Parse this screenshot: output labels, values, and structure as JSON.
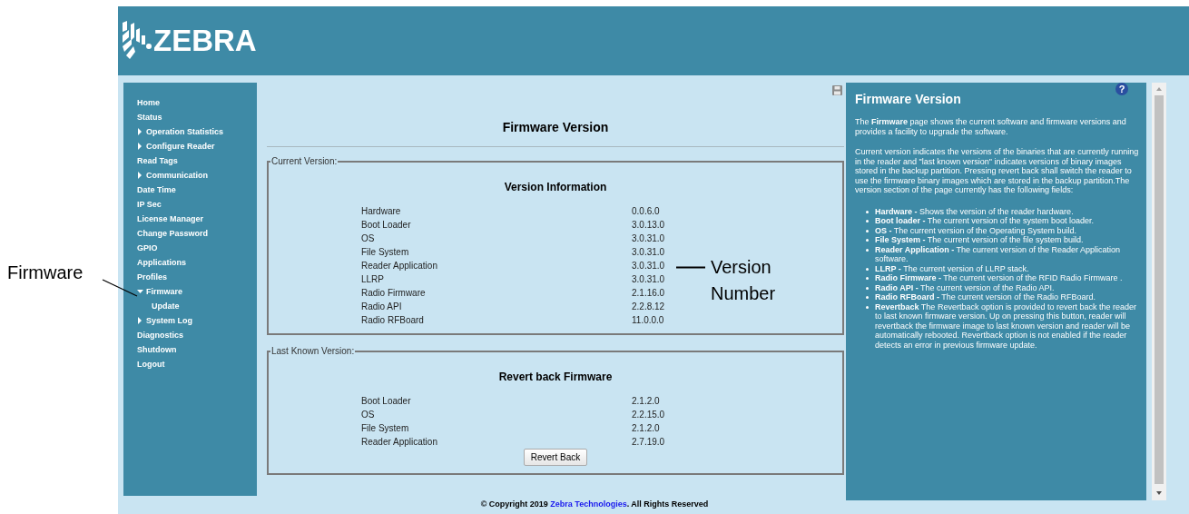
{
  "header": {
    "brand": "ZEBRA"
  },
  "sidebar": {
    "items": [
      {
        "label": "Home",
        "kind": "link"
      },
      {
        "label": "Status",
        "kind": "link"
      },
      {
        "label": "Operation Statistics",
        "kind": "group",
        "expanded": false
      },
      {
        "label": "Configure Reader",
        "kind": "group",
        "expanded": false
      },
      {
        "label": "Read Tags",
        "kind": "link"
      },
      {
        "label": "Communication",
        "kind": "group",
        "expanded": false
      },
      {
        "label": "Date Time",
        "kind": "link"
      },
      {
        "label": "IP Sec",
        "kind": "link"
      },
      {
        "label": "License Manager",
        "kind": "link"
      },
      {
        "label": "Change Password",
        "kind": "link"
      },
      {
        "label": "GPIO",
        "kind": "link"
      },
      {
        "label": "Applications",
        "kind": "link"
      },
      {
        "label": "Profiles",
        "kind": "link"
      },
      {
        "label": "Firmware",
        "kind": "group",
        "expanded": true,
        "children": [
          {
            "label": "Update",
            "kind": "link"
          }
        ]
      },
      {
        "label": "System Log",
        "kind": "group",
        "expanded": false
      },
      {
        "label": "Diagnostics",
        "kind": "link"
      },
      {
        "label": "Shutdown",
        "kind": "link"
      },
      {
        "label": "Logout",
        "kind": "link"
      }
    ]
  },
  "main": {
    "title": "Firmware Version",
    "sections": [
      {
        "legend": "Current Version:",
        "heading": "Version Information",
        "rows": [
          {
            "name": "Hardware",
            "value": "0.0.6.0"
          },
          {
            "name": "Boot Loader",
            "value": "3.0.13.0"
          },
          {
            "name": "OS",
            "value": "3.0.31.0"
          },
          {
            "name": "File System",
            "value": "3.0.31.0"
          },
          {
            "name": "Reader Application",
            "value": "3.0.31.0"
          },
          {
            "name": "LLRP",
            "value": "3.0.31.0"
          },
          {
            "name": "Radio Firmware",
            "value": "2.1.16.0"
          },
          {
            "name": "Radio API",
            "value": "2.2.8.12"
          },
          {
            "name": "Radio RFBoard",
            "value": "11.0.0.0"
          }
        ]
      },
      {
        "legend": "Last Known Version:",
        "heading": "Revert back Firmware",
        "rows": [
          {
            "name": "Boot Loader",
            "value": "2.1.2.0"
          },
          {
            "name": "OS",
            "value": "2.2.15.0"
          },
          {
            "name": "File System",
            "value": "2.1.2.0"
          },
          {
            "name": "Reader Application",
            "value": "2.7.19.0"
          }
        ],
        "button": "Revert Back"
      }
    ],
    "footer": {
      "prefix": "© Copyright 2019 ",
      "link": "Zebra Technologies",
      "suffix": ". All Rights Reserved"
    }
  },
  "help": {
    "button": "?",
    "title": "Firmware Version",
    "paragraphs": [
      "The **Firmware** page shows the current software and firmware versions and provides a facility to upgrade the software.",
      "Current version indicates the versions of the binaries that are currently running in the reader and \"last known version\" indicates versions of binary images stored in the backup partition. Pressing revert back shall switch the reader to use the firmware binary images which are stored in the backup partition.The version section of the page currently has the following fields:"
    ],
    "bullets": [
      "**Hardware -** Shows the version of the reader hardware.",
      "**Boot loader -** The current version of the system boot loader.",
      "**OS -** The current version of the Operating System build.",
      "**File System -** The current version of the file system build.",
      "**Reader Application -** The current version of the Reader Application software.",
      "**LLRP -** The current version of LLRP stack.",
      "**Radio Firmware -** The current version of the RFID Radio Firmware .",
      "**Radio API -** The current version of the Radio API.",
      "**Radio RFBoard -** The current version of the Radio RFBoard.",
      "**Revertback** The Revertback option is provided to revert back the reader to last known firmware version. Up on pressing this button, reader will revertback the firmware image to last known version and reader will be automatically rebooted. Revertback option is not enabled if the reader detects an error in previous firmware update."
    ]
  },
  "callouts": [
    {
      "kind": "sidebar",
      "text": "Firmware"
    },
    {
      "kind": "version",
      "text": "Version Number"
    }
  ]
}
